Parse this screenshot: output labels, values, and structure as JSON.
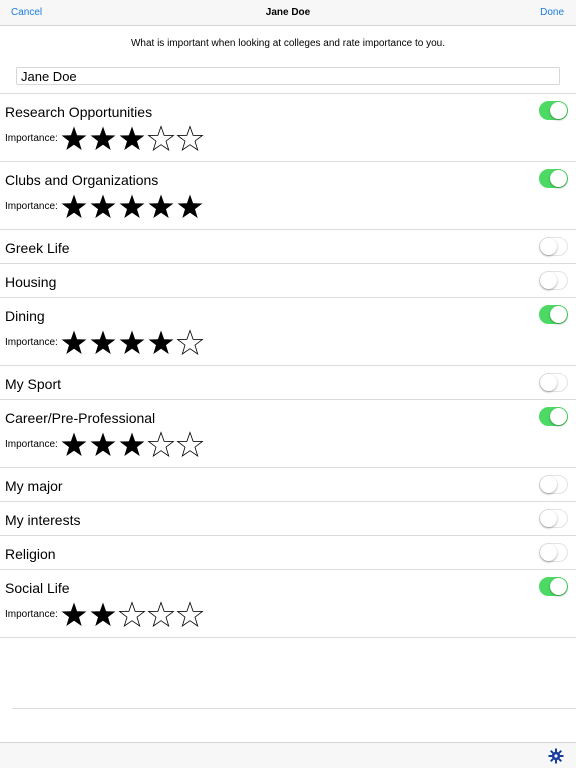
{
  "nav": {
    "cancel": "Cancel",
    "title": "Jane Doe",
    "done": "Done"
  },
  "subtitle": "What is important when looking at colleges and rate importance to you.",
  "name_field": {
    "value": "Jane Doe"
  },
  "importance_label": "Importance:",
  "max_stars": 5,
  "colors": {
    "accent": "#1b7ce0",
    "toggle_on": "#4cd964",
    "toolbar_icon": "#1b3d9e"
  },
  "toolbar": {
    "icon": "gear-icon"
  },
  "rows": [
    {
      "label": "Research Opportunities",
      "enabled": true,
      "rating": 3
    },
    {
      "label": "Clubs and Organizations",
      "enabled": true,
      "rating": 5
    },
    {
      "label": "Greek Life",
      "enabled": false
    },
    {
      "label": "Housing",
      "enabled": false
    },
    {
      "label": "Dining",
      "enabled": true,
      "rating": 4
    },
    {
      "label": "My Sport",
      "enabled": false
    },
    {
      "label": "Career/Pre-Professional",
      "enabled": true,
      "rating": 3
    },
    {
      "label": "My major",
      "enabled": false
    },
    {
      "label": "My interests",
      "enabled": false
    },
    {
      "label": "Religion",
      "enabled": false
    },
    {
      "label": "Social Life",
      "enabled": true,
      "rating": 2
    }
  ]
}
